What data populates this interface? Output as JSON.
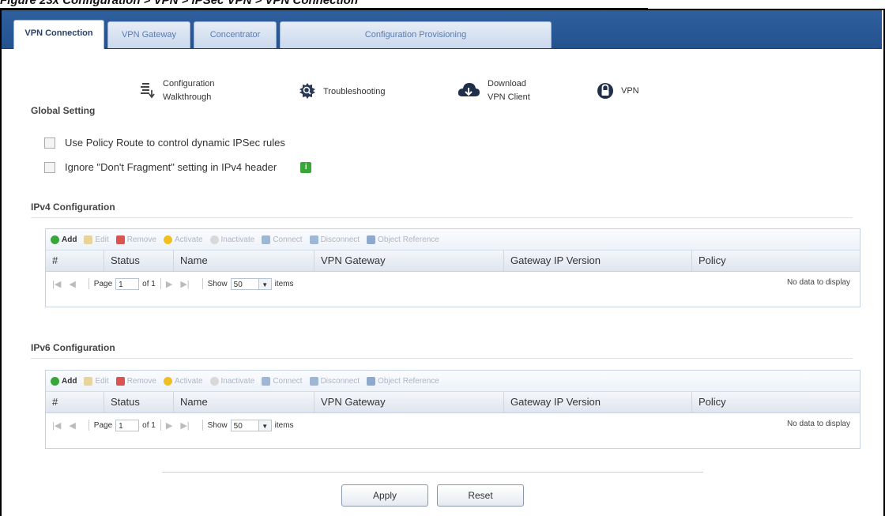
{
  "caption": "Figure 23x  Configuration > VPN > IPSec VPN > VPN Connection",
  "tabs": [
    {
      "label": "VPN Connection",
      "active": true
    },
    {
      "label": "VPN Gateway",
      "active": false
    },
    {
      "label": "Concentrator",
      "active": false
    },
    {
      "label": "Configuration Provisioning",
      "active": false
    }
  ],
  "global": {
    "title": "Global Setting",
    "links": [
      {
        "label": "Configuration\nWalkthrough",
        "icon": "wizard-icon"
      },
      {
        "label": "Troubleshooting",
        "icon": "troubleshooting-icon"
      },
      {
        "label": "Download\nVPN Client",
        "icon": "cloud-download-icon"
      },
      {
        "label": "VPN",
        "icon": "lock-icon"
      }
    ]
  },
  "options": [
    {
      "label": "Use Policy Route to control dynamic IPSec rules",
      "checked": false
    },
    {
      "label": "Ignore \"Don't Fragment\" setting in IPv4 header",
      "checked": false
    }
  ],
  "toolbar": {
    "add": "Add",
    "edit": "Edit",
    "remove": "Remove",
    "activate": "Activate",
    "inactivate": "Inactivate",
    "connect": "Connect",
    "disconnect": "Disconnect",
    "object_reference": "Object Reference"
  },
  "columns": [
    "#",
    "Status",
    "Name",
    "VPN Gateway",
    "Gateway IP Version",
    "Policy"
  ],
  "pager": {
    "page_label": "Page",
    "page": "1",
    "of_label": "of 1",
    "show_label": "Show",
    "per_page": "50",
    "items_label": "items",
    "empty": "No data to display"
  },
  "ipv4": {
    "title": "IPv4 Configuration"
  },
  "ipv6": {
    "title": "IPv6 Configuration"
  },
  "buttons": {
    "apply": "Apply",
    "reset": "Reset"
  },
  "colors": {
    "header_blue": "#2f5f9e",
    "add_green": "#3aa63a",
    "remove_red": "#d9534f",
    "activate_yellow": "#f0c020"
  }
}
